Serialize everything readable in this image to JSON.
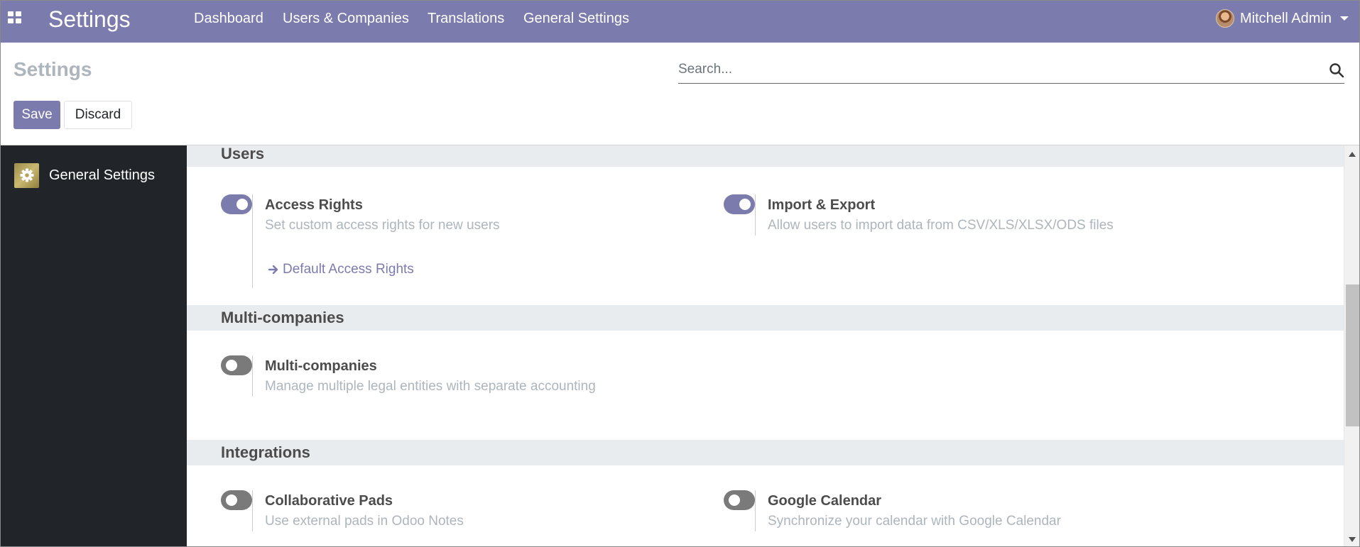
{
  "navbar": {
    "brand": "Settings",
    "menu": [
      {
        "label": "Dashboard"
      },
      {
        "label": "Users & Companies"
      },
      {
        "label": "Translations"
      },
      {
        "label": "General Settings"
      }
    ],
    "user_name": "Mitchell Admin"
  },
  "control_panel": {
    "title": "Settings",
    "search_placeholder": "Search...",
    "save_label": "Save",
    "discard_label": "Discard"
  },
  "sidebar": {
    "items": [
      {
        "label": "General Settings",
        "icon": "gear-icon"
      }
    ]
  },
  "sections": [
    {
      "title": "Users",
      "settings": [
        {
          "title": "Access Rights",
          "description": "Set custom access rights for new users",
          "enabled": true,
          "link": "Default Access Rights"
        },
        {
          "title": "Import & Export",
          "description": "Allow users to import data from CSV/XLS/XLSX/ODS files",
          "enabled": true
        }
      ]
    },
    {
      "title": "Multi-companies",
      "settings": [
        {
          "title": "Multi-companies",
          "description": "Manage multiple legal entities with separate accounting",
          "enabled": false
        }
      ]
    },
    {
      "title": "Integrations",
      "settings": [
        {
          "title": "Collaborative Pads",
          "description": "Use external pads in Odoo Notes",
          "enabled": false
        },
        {
          "title": "Google Calendar",
          "description": "Synchronize your calendar with Google Calendar",
          "enabled": false
        }
      ]
    }
  ],
  "colors": {
    "brand": "#7c7bad",
    "sidebar": "#212529",
    "section_bar": "#e9ecef",
    "muted_text": "#adb5bd",
    "toggle_off": "#7a7a7a"
  }
}
